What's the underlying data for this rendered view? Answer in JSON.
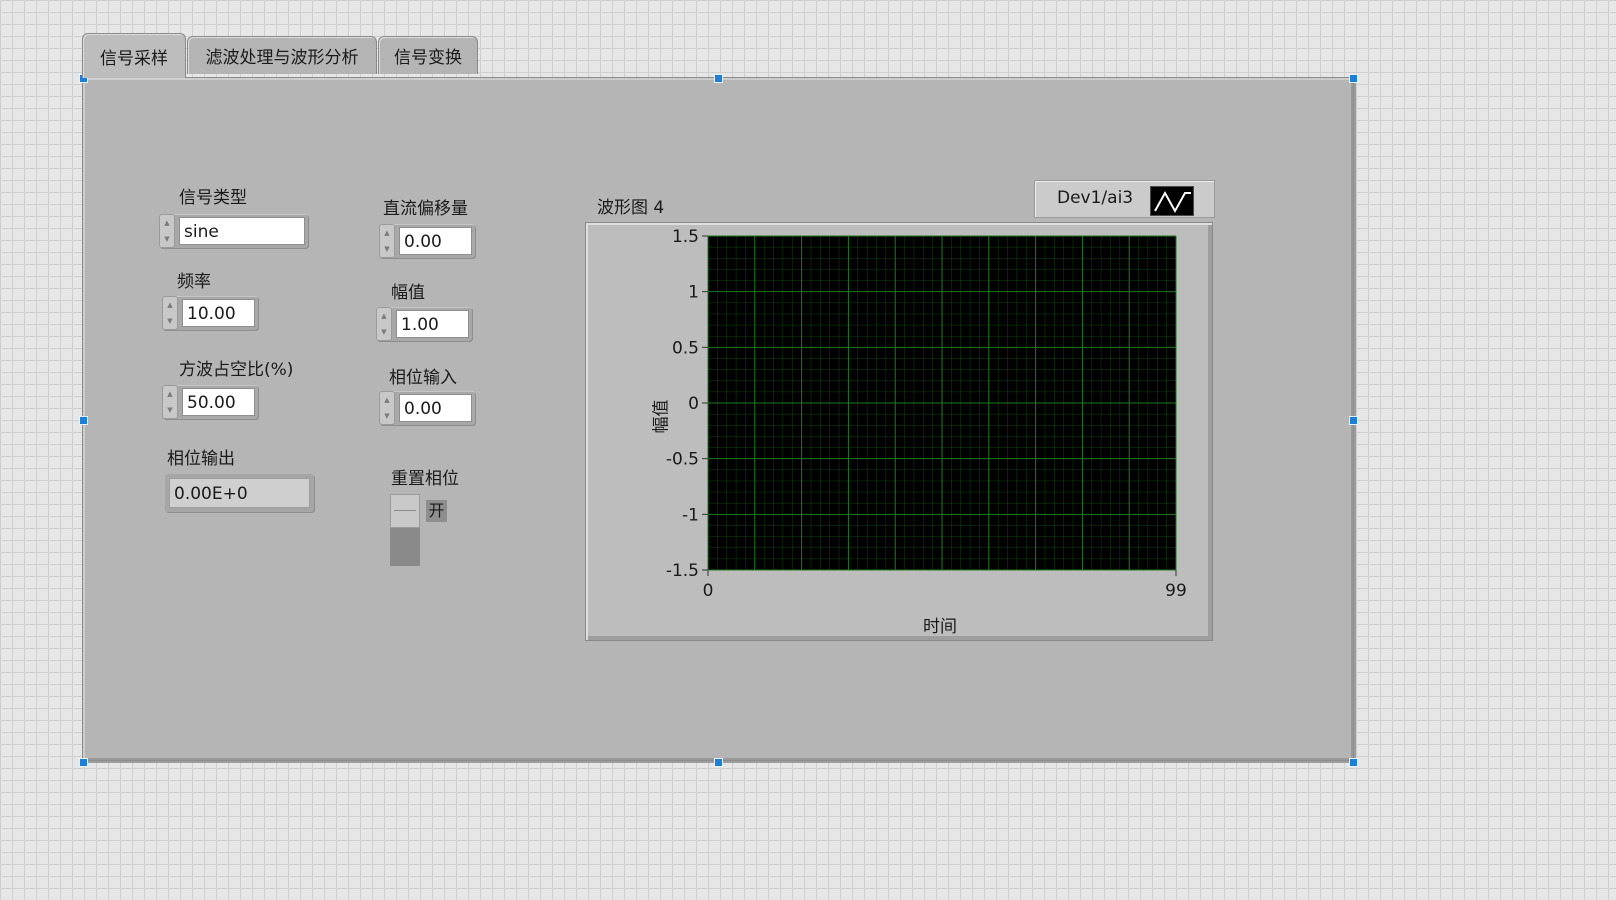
{
  "tabs": [
    "信号采样",
    "滤波处理与波形分析",
    "信号变换"
  ],
  "controls": {
    "signal_type": {
      "label": "信号类型",
      "value": "sine"
    },
    "frequency": {
      "label": "频率",
      "value": "10.00"
    },
    "duty_cycle": {
      "label": "方波占空比(%)",
      "value": "50.00"
    },
    "phase_out": {
      "label": "相位输出",
      "value": "0.00E+0"
    },
    "dc_offset": {
      "label": "直流偏移量",
      "value": "0.00"
    },
    "amplitude": {
      "label": "幅值",
      "value": "1.00"
    },
    "phase_in": {
      "label": "相位输入",
      "value": "0.00"
    },
    "reset_phase": {
      "label": "重置相位",
      "state_label": "开"
    }
  },
  "chart": {
    "title": "波形图 4",
    "legend_label": "Dev1/ai3",
    "ylabel": "幅值",
    "xlabel": "时间",
    "colors": {
      "plot_bg": "#000000",
      "grid": "#1f7a1f"
    }
  },
  "chart_data": {
    "type": "line",
    "title": "波形图 4",
    "xlabel": "时间",
    "ylabel": "幅值",
    "xlim": [
      0,
      99
    ],
    "ylim": [
      -1.5,
      1.5
    ],
    "x_ticks": [
      "0",
      "99"
    ],
    "y_ticks": [
      "1.5",
      "1",
      "0.5",
      "0",
      "-0.5",
      "-1",
      "-1.5"
    ],
    "grid": true,
    "legend_position": "top-right",
    "series": [
      {
        "name": "Dev1/ai3",
        "values": []
      }
    ]
  }
}
